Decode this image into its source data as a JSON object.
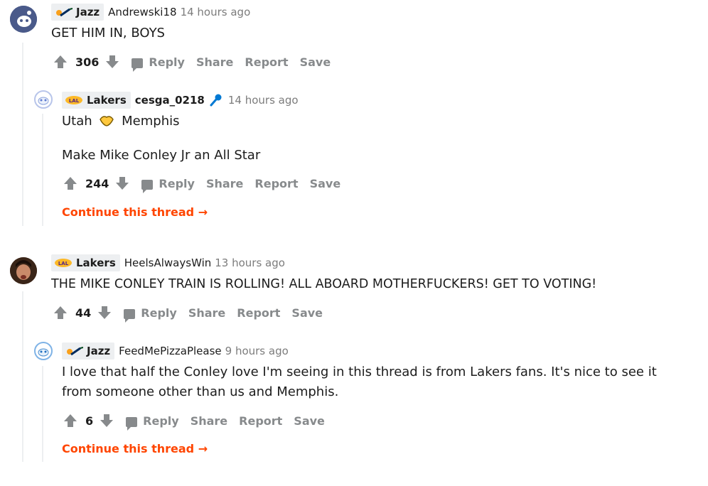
{
  "comments": [
    {
      "flair": "Jazz",
      "username": "Andrewski18",
      "time": "14 hours ago",
      "body": "GET HIM IN, BOYS",
      "score": "306"
    },
    {
      "flair": "Lakers",
      "username": "cesga_0218",
      "username_icon": "microphone-icon",
      "time": "14 hours ago",
      "body_line1_a": "Utah",
      "body_emoji": "handshake-icon",
      "body_line1_b": "Memphis",
      "body_line2": "Make Mike Conley Jr an All Star",
      "score": "244",
      "continue": "Continue this thread"
    },
    {
      "flair": "Lakers",
      "username": "HeelsAlwaysWin",
      "time": "13 hours ago",
      "body": "THE MIKE CONLEY TRAIN IS ROLLING! ALL ABOARD MOTHERFUCKERS! GET TO VOTING!",
      "score": "44"
    },
    {
      "flair": "Jazz",
      "username": "FeedMePizzaPlease",
      "time": "9 hours ago",
      "body": "I love that half the Conley love I'm seeing in this thread is from Lakers fans. It's nice to see it from someone other than us and Memphis.",
      "score": "6",
      "continue": "Continue this thread"
    }
  ],
  "actions": {
    "reply": "Reply",
    "share": "Share",
    "report": "Report",
    "save": "Save"
  },
  "colors": {
    "accent": "#ff4500",
    "muted": "#878a8c",
    "flair_bg": "#edeff1",
    "jazz_navy": "#002b5c",
    "lakers_purple": "#552583",
    "lakers_gold": "#fdb927"
  }
}
